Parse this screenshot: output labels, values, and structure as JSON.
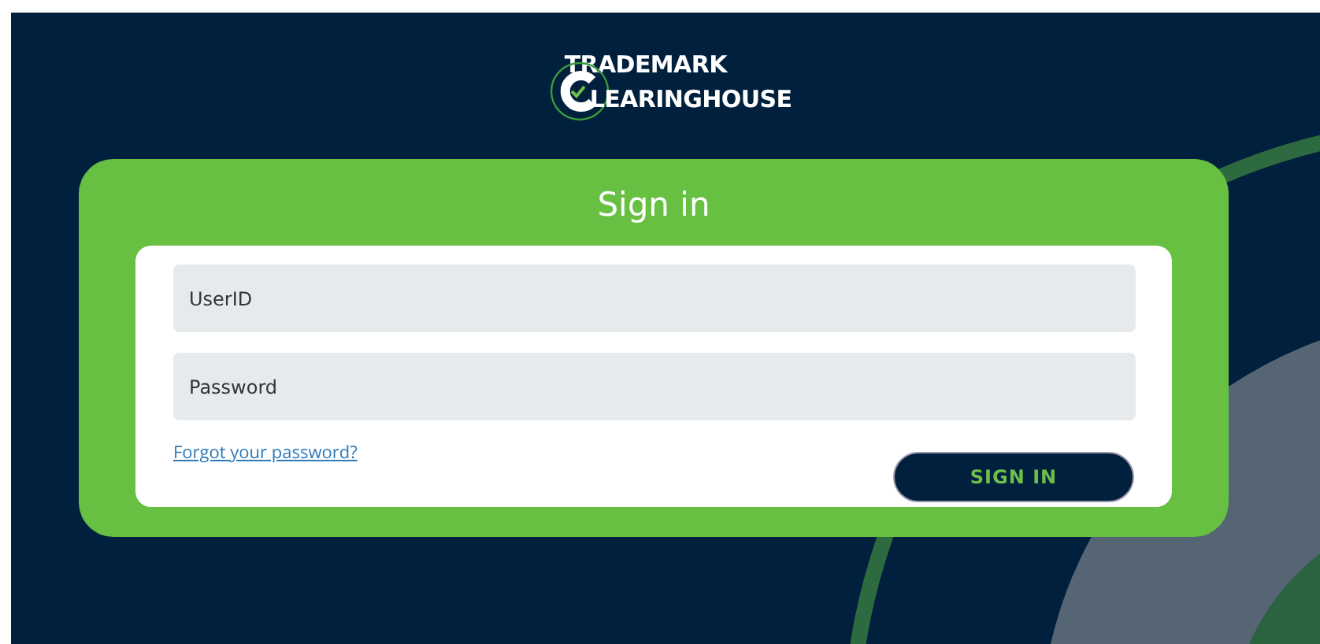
{
  "logo": {
    "line_1": "TRADEMARK",
    "line_2": "LEARINGHOUSE"
  },
  "sign_in": {
    "title": "Sign in",
    "fields": [
      {
        "placeholder": "UserID"
      },
      {
        "placeholder": "Password"
      }
    ],
    "forgot_link": "Forgot your password?",
    "button": "SIGN IN"
  }
}
